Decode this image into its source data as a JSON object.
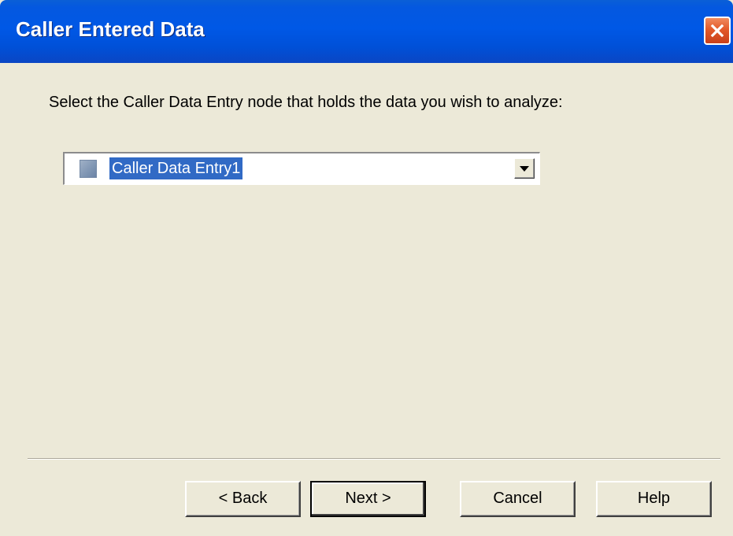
{
  "window": {
    "title": "Caller Entered Data",
    "close_icon": "close-icon"
  },
  "instructions": "Select the Caller Data Entry node that holds the data you wish to analyze:",
  "node_select": {
    "selected_value": "Caller Data Entry1",
    "item_icon": "node-icon",
    "arrow_icon": "chevron-down-icon"
  },
  "buttons": {
    "back_label": "< Back",
    "next_label": "Next >",
    "cancel_label": "Cancel",
    "help_label": "Help"
  },
  "colors": {
    "titlebar": "#0058e6",
    "close_button": "#e35a2a",
    "dialog_background": "#ece9d8",
    "selection_highlight": "#316ac5"
  }
}
